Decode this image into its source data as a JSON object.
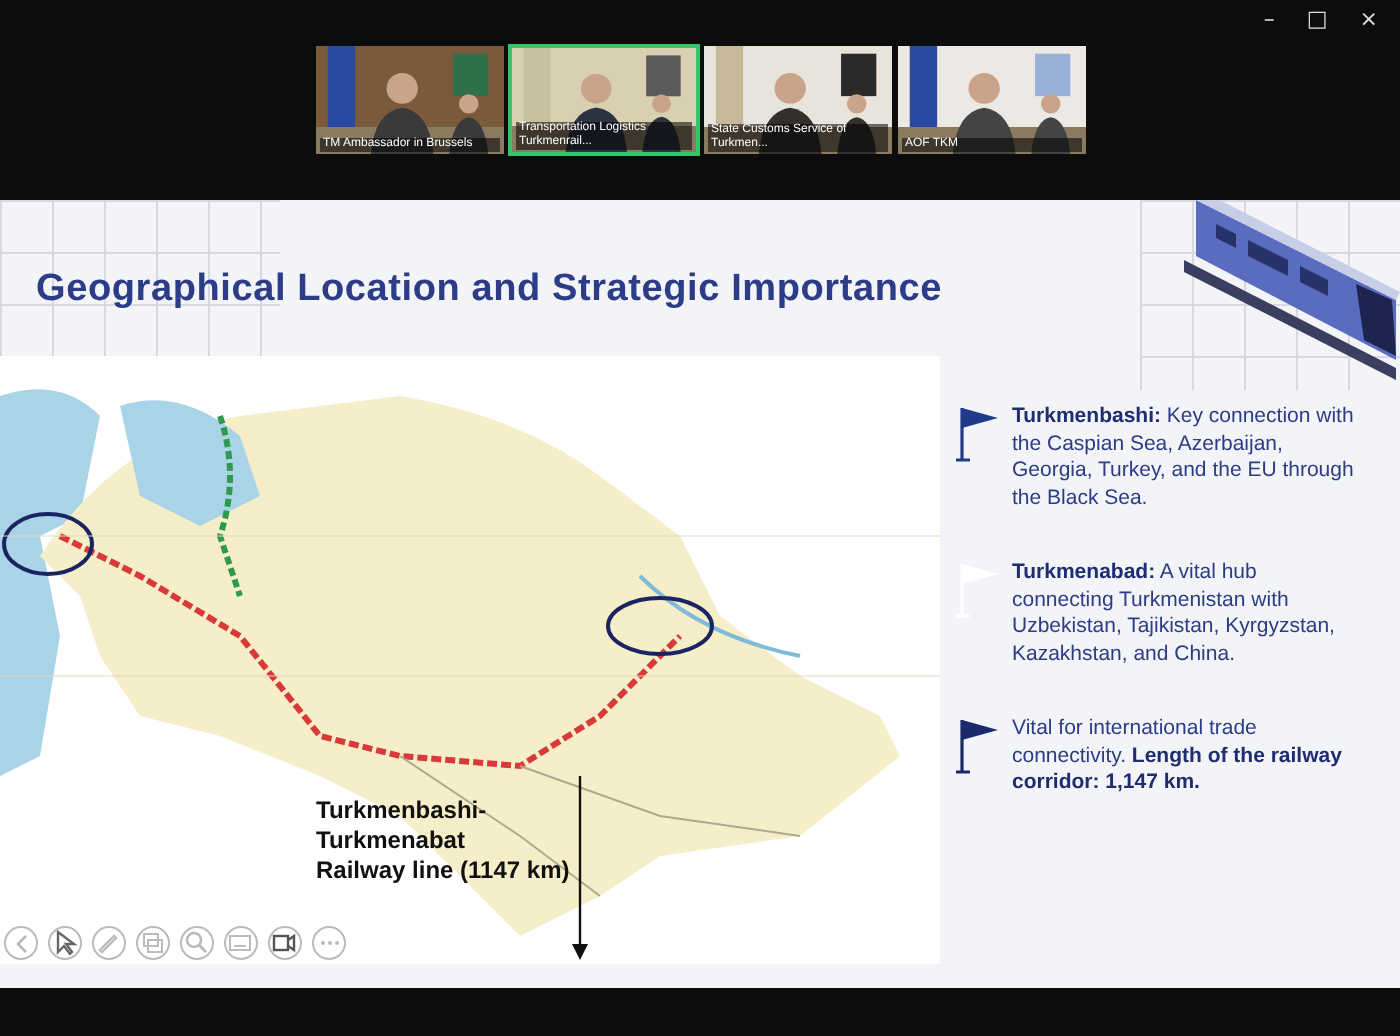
{
  "window": {
    "controls": [
      "–",
      "□",
      "×"
    ]
  },
  "participants": [
    {
      "name": "TM Ambassador in Brussels",
      "active": false
    },
    {
      "name": "Transportation Logistics Turkmenrail...",
      "active": true
    },
    {
      "name": "State Customs Service of Turkmen...",
      "active": false
    },
    {
      "name": "AOF TKM",
      "active": false
    }
  ],
  "slide": {
    "title": "Geographical Location and Strategic Importance",
    "map": {
      "kind": "picture",
      "annotation": "Turkmenbashi-\nTurkmenabat\nRailway line (1147 km)"
    },
    "points": [
      {
        "text": "**Turkmenbashi:** Key connection with the Caspian Sea, Azerbaijan, Georgia, Turkey, and the EU through the Black Sea.",
        "color": "#1f3a8a"
      },
      {
        "text": "**Turkmenabad:** A vital hub connecting Turkmenistan with Uzbekistan, Tajikistan, Kyrgyzstan, Kazakhstan, and China.",
        "color": "#ffffff"
      },
      {
        "text": "Vital for international trade connectivity. **Length of the railway corridor: 1,147 km.**",
        "color": "#1c2a6b"
      }
    ]
  },
  "toolbar": [
    {
      "kind": "back"
    },
    {
      "kind": "pointer"
    },
    {
      "kind": "pen"
    },
    {
      "kind": "slides"
    },
    {
      "kind": "zoom"
    },
    {
      "kind": "subtitles"
    },
    {
      "kind": "camera"
    },
    {
      "kind": "more"
    }
  ]
}
